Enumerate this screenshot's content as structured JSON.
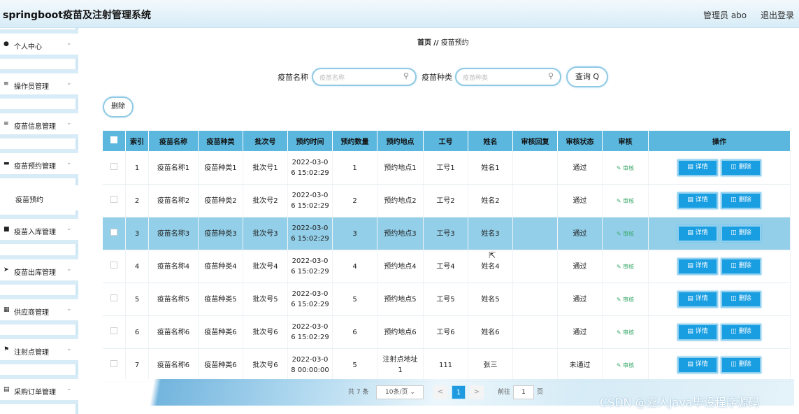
{
  "header": {
    "title": "springboot疫苗及注射管理系统",
    "admin": "管理员 abo",
    "logout": "退出登录"
  },
  "sidebar": {
    "items": [
      {
        "icon": "user-icon",
        "label": "个人中心"
      },
      {
        "icon": "list-icon",
        "label": "操作员管理"
      },
      {
        "icon": "list-icon",
        "label": "疫苗信息管理"
      },
      {
        "icon": "box-icon",
        "label": "疫苗预约管理"
      },
      {
        "icon": "box-icon",
        "label": "疫苗入库管理"
      },
      {
        "icon": "send-icon",
        "label": "疫苗出库管理"
      },
      {
        "icon": "grid-icon",
        "label": "供应商管理"
      },
      {
        "icon": "flag-icon",
        "label": "注射点管理"
      },
      {
        "icon": "doc-icon",
        "label": "采购订单管理"
      }
    ],
    "submenu": "疫苗预约"
  },
  "breadcrumb": {
    "home": "首页",
    "sep": "//",
    "current": "疫苗预约"
  },
  "search": {
    "name_label": "疫苗名称",
    "name_placeholder": "疫苗名称",
    "type_label": "疫苗种类",
    "type_placeholder": "疫苗种类",
    "query_label": "查询 Q"
  },
  "delete_label": "删除",
  "table": {
    "headers": [
      "索引",
      "疫苗名称",
      "疫苗种类",
      "批次号",
      "预约时间",
      "预约数量",
      "预约地点",
      "工号",
      "姓名",
      "审核回复",
      "审核状态",
      "审核",
      "操作"
    ],
    "audit_label": "审核",
    "detail_label": "详情",
    "delete_label": "删除",
    "rows": [
      [
        "1",
        "疫苗名称1",
        "疫苗种类1",
        "批次号1",
        "2022-03-0",
        "6 15:02:29",
        "1",
        "预约地点1",
        "",
        "工号1",
        "姓名1",
        "",
        "通过"
      ],
      [
        "2",
        "疫苗名称2",
        "疫苗种类2",
        "批次号2",
        "2022-03-0",
        "6 15:02:29",
        "2",
        "预约地点2",
        "",
        "工号2",
        "姓名2",
        "",
        "通过"
      ],
      [
        "3",
        "疫苗名称3",
        "疫苗种类3",
        "批次号3",
        "2022-03-0",
        "6 15:02:29",
        "3",
        "预约地点3",
        "",
        "工号3",
        "姓名3",
        "",
        "通过"
      ],
      [
        "4",
        "疫苗名称4",
        "疫苗种类4",
        "批次号4",
        "2022-03-0",
        "6 15:02:29",
        "4",
        "预约地点4",
        "",
        "工号4",
        "姓名4",
        "",
        "通过"
      ],
      [
        "5",
        "疫苗名称5",
        "疫苗种类5",
        "批次号5",
        "2022-03-0",
        "6 15:02:29",
        "5",
        "预约地点5",
        "",
        "工号5",
        "姓名5",
        "",
        "通过"
      ],
      [
        "6",
        "疫苗名称6",
        "疫苗种类6",
        "批次号6",
        "2022-03-0",
        "6 15:02:29",
        "6",
        "预约地点6",
        "",
        "工号6",
        "姓名6",
        "",
        "通过"
      ],
      [
        "7",
        "疫苗名称6",
        "疫苗种类6",
        "批次号6",
        "2022-03-0",
        "8 00:00:00",
        "5",
        "注射点地址",
        "1",
        "111",
        "张三",
        "",
        "未通过"
      ]
    ]
  },
  "pager": {
    "total": "共 7 条",
    "size": "10条/页",
    "prev": "<",
    "current": "1",
    "next": ">",
    "goto": "前往",
    "page_value": "1",
    "page_unit": "页"
  },
  "watermark": "CSDN @嘉人Java毕设程序源码"
}
